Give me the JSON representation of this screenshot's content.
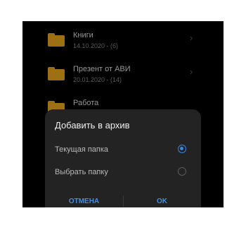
{
  "files": [
    {
      "name": "Книги",
      "meta": "14.10.2020 - (6)"
    },
    {
      "name": "Презент  от АВИ",
      "meta": "20.01.2020 - (14)"
    },
    {
      "name": "Работа",
      "meta": ""
    }
  ],
  "icons": {
    "folder": "folder-icon",
    "chevron": "chevron-right-icon"
  },
  "chevron_glyph": "›",
  "dialog": {
    "title": "Добавить в архив",
    "options": [
      {
        "label": "Текущая папка",
        "selected": true
      },
      {
        "label": "Выбрать папку",
        "selected": false
      }
    ],
    "cancel_label": "ОТМЕНА",
    "ok_label": "OK"
  },
  "colors": {
    "background": "#000000",
    "folder": "#f3ad1f",
    "dialog": "#232323",
    "accent": "#3b86df",
    "button_text": "#4a8ddb"
  }
}
